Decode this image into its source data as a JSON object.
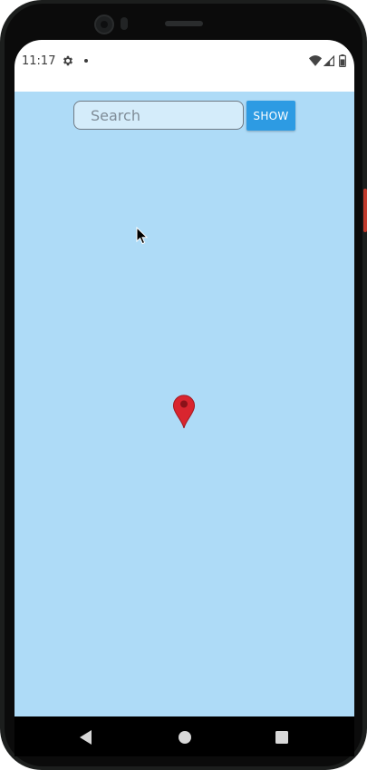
{
  "status_bar": {
    "time": "11:17",
    "icons": [
      "gear-icon",
      "notification-dot-icon",
      "wifi-icon",
      "cell-signal-icon",
      "battery-icon"
    ]
  },
  "search": {
    "placeholder": "Search",
    "value": ""
  },
  "show_button": {
    "label": "SHOW",
    "color": "#2d9be3"
  },
  "map": {
    "background_color": "#aedbf7",
    "marker_icon": "map-pin-icon",
    "marker_color": "#d9252f"
  },
  "nav_bar": {
    "icons": [
      "back-icon",
      "home-icon",
      "recents-icon"
    ]
  }
}
